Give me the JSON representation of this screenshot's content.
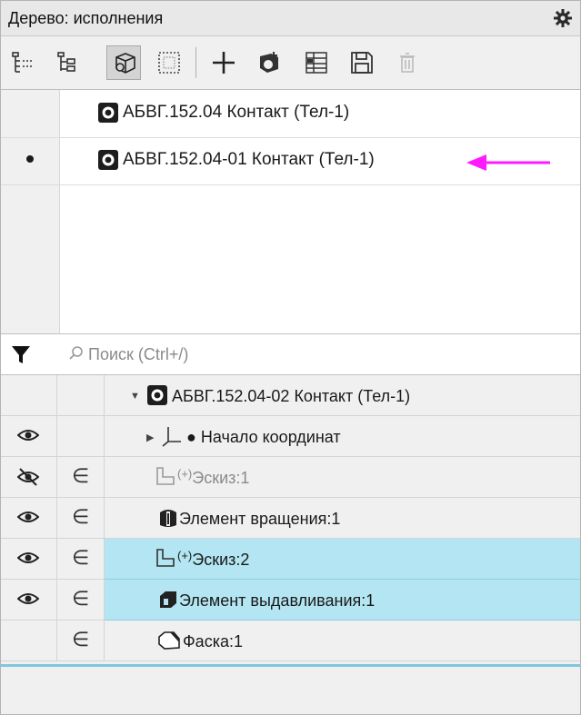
{
  "panel": {
    "title": "Дерево: исполнения",
    "gear_icon": "gear-icon"
  },
  "toolbar": {
    "buttons": [
      {
        "name": "tree-view-1-icon",
        "active": false
      },
      {
        "name": "tree-view-2-icon",
        "active": false
      },
      {
        "name": "show-variants-icon",
        "active": true
      },
      {
        "name": "select-area-icon",
        "active": false
      },
      {
        "name": "add-icon",
        "active": false
      },
      {
        "name": "refresh-add-icon",
        "active": false
      },
      {
        "name": "table-icon",
        "active": false
      },
      {
        "name": "save-icon",
        "active": false
      },
      {
        "name": "delete-icon",
        "active": false,
        "disabled": true
      }
    ]
  },
  "variants": [
    {
      "label": "АБВГ.152.04 Контакт (Тел-1)",
      "current": false
    },
    {
      "label": "АБВГ.152.04-01 Контакт (Тел-1)",
      "current": true
    }
  ],
  "annotation": {
    "color": "#ff19ff"
  },
  "search": {
    "placeholder": "Поиск (Ctrl+/)",
    "value": ""
  },
  "tree": {
    "root": {
      "label": "АБВГ.152.04-02 Контакт (Тел-1)",
      "expanded": true
    },
    "items": [
      {
        "label": "● Начало координат",
        "visible": "shown",
        "in_variant": false,
        "dim": false,
        "selected": false,
        "icon": "origin-axes-icon",
        "has_twisty": true
      },
      {
        "label": "Эскиз:1",
        "prefix": "(+)",
        "visible": "hidden",
        "in_variant": true,
        "dim": true,
        "selected": false,
        "icon": "sketch-icon",
        "has_twisty": false
      },
      {
        "label": "Элемент вращения:1",
        "visible": "shown",
        "in_variant": true,
        "dim": false,
        "selected": false,
        "icon": "revolve-feature-icon",
        "has_twisty": false
      },
      {
        "label": "Эскиз:2",
        "prefix": "(+)",
        "visible": "shown",
        "in_variant": true,
        "dim": false,
        "selected": true,
        "icon": "sketch-icon",
        "has_twisty": false
      },
      {
        "label": "Элемент выдавливания:1",
        "visible": "shown",
        "in_variant": true,
        "dim": false,
        "selected": true,
        "icon": "extrude-feature-icon",
        "has_twisty": false
      },
      {
        "label": "Фаска:1",
        "visible": "none",
        "in_variant": true,
        "dim": false,
        "selected": false,
        "icon": "chamfer-icon",
        "has_twisty": false
      }
    ],
    "element_symbol": "∈",
    "selection_color": "#b3e5f2"
  }
}
